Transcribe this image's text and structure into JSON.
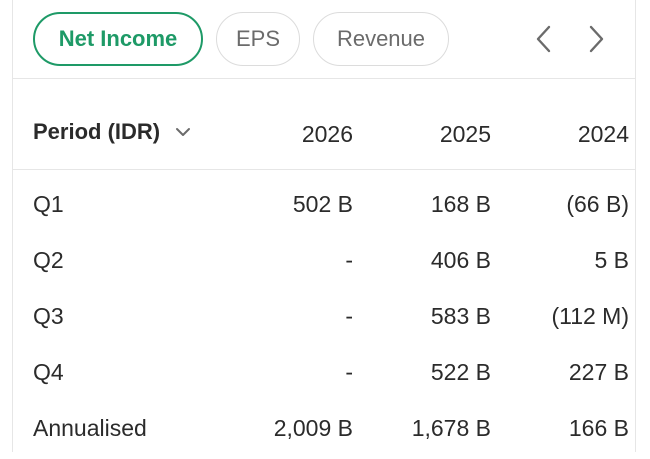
{
  "tabs": [
    {
      "label": "Net Income",
      "active": true
    },
    {
      "label": "EPS",
      "active": false
    },
    {
      "label": "Revenue",
      "active": false
    }
  ],
  "nav": {
    "prev_icon": "chevron-left-icon",
    "next_icon": "chevron-right-icon"
  },
  "table": {
    "period_selector": "Period (IDR)",
    "columns": [
      "2026",
      "2025",
      "2024"
    ],
    "rows": [
      {
        "label": "Q1",
        "values": [
          "502 B",
          "168 B",
          "(66 B)"
        ]
      },
      {
        "label": "Q2",
        "values": [
          "-",
          "406 B",
          "5 B"
        ]
      },
      {
        "label": "Q3",
        "values": [
          "-",
          "583 B",
          "(112 M)"
        ]
      },
      {
        "label": "Q4",
        "values": [
          "-",
          "522 B",
          "227 B"
        ]
      },
      {
        "label": "Annualised",
        "values": [
          "2,009 B",
          "1,678 B",
          "166 B"
        ]
      }
    ]
  },
  "colors": {
    "accent": "#1e9a67",
    "border": "#e6e6e6",
    "text": "#2b2b2b",
    "muted": "#6b6b6b"
  }
}
